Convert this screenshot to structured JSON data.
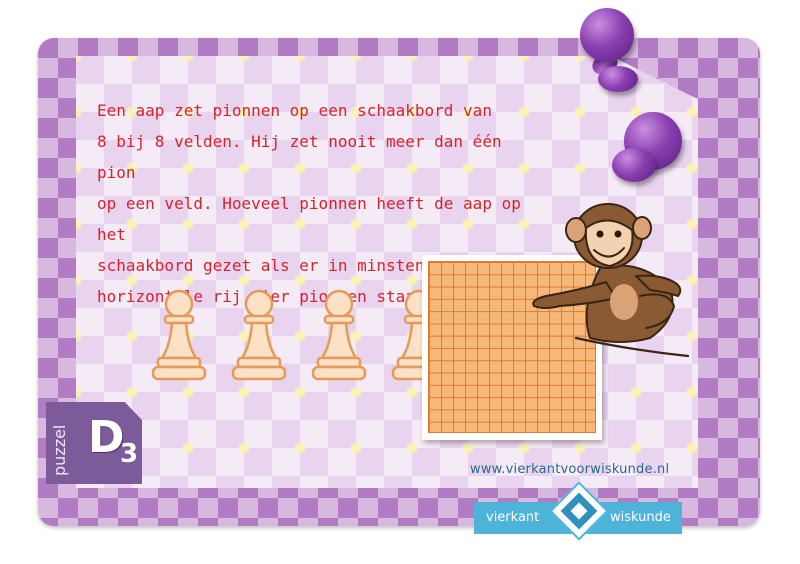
{
  "puzzle": {
    "question_lines": [
      "Een aap zet pionnen op een schaakbord van",
      "8 bij 8 velden. Hij zet nooit meer dan één pion",
      "op een veld. Hoeveel pionnen heeft de aap op het",
      "schaakbord gezet als er in minstens één",
      "horizontale rij vier pionnen staan?"
    ],
    "label_word": "puzzel",
    "label_letter": "D",
    "label_number": "3",
    "pawn_count": 4
  },
  "footer": {
    "url": "www.vierkantvoorwiskunde.nl",
    "logo_left": "vierkant",
    "logo_right": "wiskunde"
  },
  "icons": [
    "push-pin-icon",
    "pawn-icon",
    "chessboard-icon",
    "monkey-icon",
    "vierkant-logo-icon"
  ],
  "colors": {
    "frame": "#b27cc4",
    "paper": "#e9d4ef",
    "question_text": "#d8222b",
    "tab": "#7d5b9b",
    "logo_blue": "#4db3d8",
    "board": "#f6b77a"
  }
}
